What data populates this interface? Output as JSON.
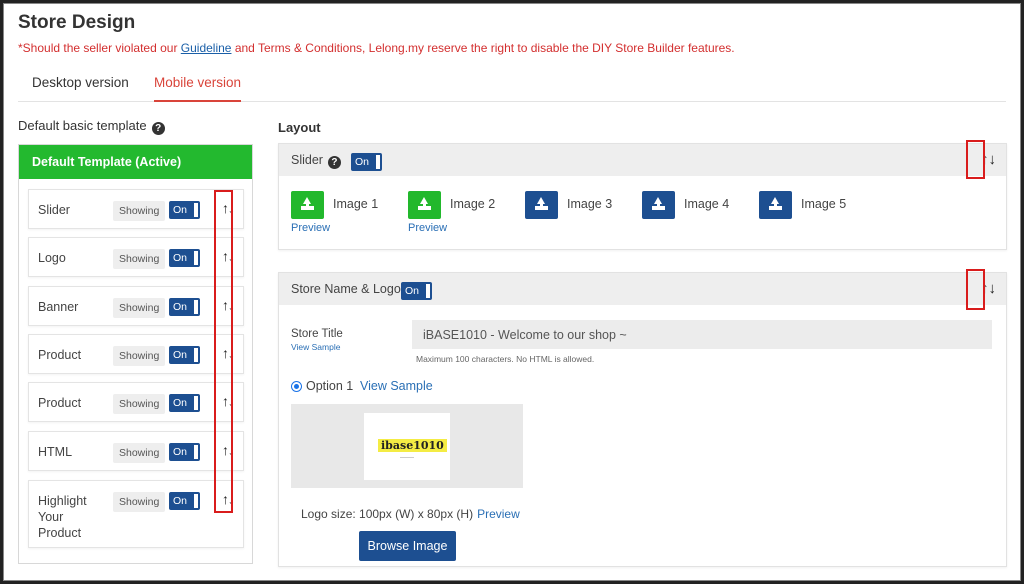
{
  "page": {
    "title": "Store Design",
    "notice_prefix": "*Should the seller violated our ",
    "notice_link": "Guideline",
    "notice_suffix": " and Terms & Conditions, Lelong.my reserve the right to disable the DIY Store Builder features."
  },
  "tabs": [
    {
      "label": "Desktop version",
      "active": false
    },
    {
      "label": "Mobile version",
      "active": true
    }
  ],
  "left_panel": {
    "heading": "Default basic template",
    "help_icon": "question-circle-icon",
    "active_template": "Default Template (Active)",
    "rows": [
      {
        "label": "Slider",
        "status": "Showing",
        "toggle": "On"
      },
      {
        "label": "Logo",
        "status": "Showing",
        "toggle": "On"
      },
      {
        "label": "Banner",
        "status": "Showing",
        "toggle": "On"
      },
      {
        "label": "Product",
        "status": "Showing",
        "toggle": "On"
      },
      {
        "label": "Product",
        "status": "Showing",
        "toggle": "On"
      },
      {
        "label": "HTML",
        "status": "Showing",
        "toggle": "On"
      },
      {
        "label": "Highlight Your Product",
        "status": "Showing",
        "toggle": "On"
      }
    ],
    "move_arrows": "↑↓"
  },
  "layout": {
    "heading": "Layout",
    "slider": {
      "title": "Slider",
      "toggle": "On",
      "arrows": "↑↓",
      "images": [
        {
          "label": "Image 1",
          "uploaded": true,
          "preview": "Preview"
        },
        {
          "label": "Image 2",
          "uploaded": true,
          "preview": "Preview"
        },
        {
          "label": "Image 3",
          "uploaded": false
        },
        {
          "label": "Image 4",
          "uploaded": false
        },
        {
          "label": "Image 5",
          "uploaded": false
        }
      ]
    },
    "store_name_logo": {
      "title": "Store Name & Logo",
      "toggle": "On",
      "arrows": "↑↓",
      "store_title_label": "Store Title",
      "view_sample_small": "View Sample",
      "store_title_value": "iBASE1010 - Welcome to our shop ~",
      "hint": "Maximum 100 characters. No HTML is allowed.",
      "option_label": "Option 1",
      "view_sample": "View Sample",
      "logo_text": "ibase1010",
      "logo_size": "Logo size: 100px (W) x 80px (H)",
      "logo_preview": "Preview",
      "browse_button": "Browse Image"
    }
  },
  "colors": {
    "accent_red": "#d9443a",
    "active_green": "#22b82c",
    "primary_blue": "#1d4f91",
    "link_blue": "#2a6fb5",
    "highlight_box": "#d91c1c"
  }
}
